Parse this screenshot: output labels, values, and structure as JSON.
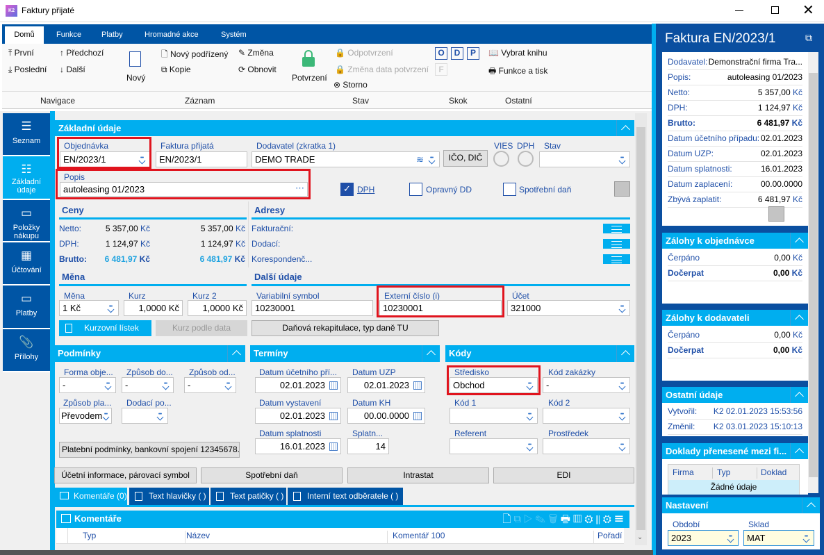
{
  "window": {
    "title": "Faktury přijaté",
    "logo": "K2"
  },
  "ribbon": {
    "tabs": [
      "Domů",
      "Funkce",
      "Platby",
      "Hromadné akce",
      "Systém"
    ],
    "active_tab": "Domů",
    "navigace": {
      "first": "První",
      "prev": "Předchozí",
      "last": "Poslední",
      "next": "Další",
      "group": "Navigace"
    },
    "zaznam": {
      "new": "Nový",
      "new_child": "Nový podřízený",
      "copy": "Kopie",
      "change": "Změna",
      "refresh": "Obnovit",
      "group": "Záznam"
    },
    "stav": {
      "confirm": "Potvrzení",
      "unconfirm": "Odpotvrzení",
      "change_date": "Změna data potvrzení",
      "storno": "Storno",
      "group": "Stav"
    },
    "skok": {
      "o": "O",
      "d": "D",
      "p": "P",
      "f": "F",
      "group": "Skok"
    },
    "ostatni": {
      "book": "Vybrat knihu",
      "print": "Funkce a tisk",
      "group": "Ostatní"
    }
  },
  "nav": [
    {
      "label": "Seznam",
      "icon": "list-icon"
    },
    {
      "label": "Základní údaje",
      "icon": "bullet-list-icon",
      "active": true
    },
    {
      "label": "Položky nákupu",
      "icon": "box-icon"
    },
    {
      "label": "Účtování",
      "icon": "calculator-icon"
    },
    {
      "label": "Platby",
      "icon": "box-icon"
    },
    {
      "label": "Přílohy",
      "icon": "paperclip-icon"
    }
  ],
  "zakladni": {
    "title": "Základní údaje",
    "objednavka": {
      "label": "Objednávka",
      "value": "EN/2023/1"
    },
    "faktura": {
      "label": "Faktura přijatá",
      "value": "EN/2023/1"
    },
    "dodavatel": {
      "label": "Dodavatel (zkratka 1)",
      "value": "DEMO TRADE"
    },
    "ico_dic": "IČO, DIČ",
    "vies": "VIES",
    "dph_status": "DPH",
    "stav": {
      "label": "Stav",
      "value": ""
    },
    "popis": {
      "label": "Popis",
      "value": "autoleasing 01/2023"
    },
    "dph_check": {
      "label": "DPH",
      "checked": true
    },
    "opravny": {
      "label": "Opravný DD",
      "checked": false
    },
    "spotrebni": {
      "label": "Spotřební daň",
      "checked": false
    }
  },
  "ceny": {
    "title": "Ceny",
    "rows": [
      {
        "label": "Netto:",
        "v1": "5 357,00",
        "v2": "5 357,00",
        "cur": "Kč"
      },
      {
        "label": "DPH:",
        "v1": "1 124,97",
        "v2": "1 124,97",
        "cur": "Kč"
      },
      {
        "label": "Brutto:",
        "v1": "6 481,97",
        "v2": "6 481,97",
        "cur": "Kč"
      }
    ]
  },
  "adresy": {
    "title": "Adresy",
    "rows": [
      "Fakturační:",
      "Dodací:",
      "Korespondenč..."
    ]
  },
  "mena": {
    "title": "Měna",
    "mena": {
      "label": "Měna",
      "value": "1 Kč"
    },
    "kurz": {
      "label": "Kurz",
      "value": "1,0000 Kč"
    },
    "kurz2": {
      "label": "Kurz 2",
      "value": "1,0000 Kč"
    },
    "kurzovni": "Kurzovní lístek",
    "kurz_podle": "Kurz podle data"
  },
  "dalsi": {
    "title": "Další údaje",
    "vs": {
      "label": "Variabilní symbol",
      "value": "10230001"
    },
    "ext": {
      "label": "Externí číslo (i)",
      "value": "10230001"
    },
    "ucet": {
      "label": "Účet",
      "value": "321000"
    },
    "rekap": "Daňová rekapitulace, typ daně TU"
  },
  "podminky": {
    "title": "Podmínky",
    "forma": {
      "label": "Forma obje...",
      "value": "-"
    },
    "zpusob_do": {
      "label": "Způsob do...",
      "value": "-"
    },
    "zpusob_od": {
      "label": "Způsob od...",
      "value": "-"
    },
    "zpusob_pla": {
      "label": "Způsob pla...",
      "value": "Převodem"
    },
    "dodaci": {
      "label": "Dodací po...",
      "value": ""
    },
    "button": "Platební podmínky, bankovní spojení 12345678..."
  },
  "terminy": {
    "title": "Termíny",
    "ucetni": {
      "label": "Datum účetního pří...",
      "value": "02.01.2023"
    },
    "uzp": {
      "label": "Datum UZP",
      "value": "02.01.2023"
    },
    "vystaveni": {
      "label": "Datum vystavení",
      "value": "02.01.2023"
    },
    "kh": {
      "label": "Datum KH",
      "value": "00.00.0000"
    },
    "splatnosti": {
      "label": "Datum splatnosti",
      "value": "16.01.2023"
    },
    "splatn": {
      "label": "Splatn...",
      "value": "14"
    }
  },
  "kody": {
    "title": "Kódy",
    "stredisko": {
      "label": "Středisko",
      "value": "Obchod"
    },
    "zakazka": {
      "label": "Kód zakázky",
      "value": "-"
    },
    "kod1": {
      "label": "Kód 1",
      "value": ""
    },
    "kod2": {
      "label": "Kód 2",
      "value": ""
    },
    "referent": {
      "label": "Referent",
      "value": ""
    },
    "prostredek": {
      "label": "Prostředek",
      "value": ""
    }
  },
  "bottom_buttons": [
    "Účetní informace, párovací symbol",
    "Spotřební daň",
    "Intrastat",
    "EDI"
  ],
  "tabs": [
    "Komentáře (0)",
    "Text hlavičky ( )",
    "Text patičky ( )",
    "Interní text odběratele ( )"
  ],
  "komentare": {
    "title": "Komentáře",
    "columns": [
      "Typ",
      "Název",
      "Komentář 100",
      "Pořadí"
    ]
  },
  "right": {
    "title": "Faktura EN/2023/1",
    "rows": [
      {
        "k": "Dodavatel:",
        "v": "Demonstrační firma Tra..."
      },
      {
        "k": "Popis:",
        "v": "autoleasing 01/2023"
      },
      {
        "k": "Netto:",
        "v": "5 357,00",
        "c": "Kč"
      },
      {
        "k": "DPH:",
        "v": "1 124,97",
        "c": "Kč"
      },
      {
        "k": "Brutto:",
        "v": "6 481,97",
        "c": "Kč",
        "bold": true
      },
      {
        "k": "Datum účetního případu:",
        "v": "02.01.2023"
      },
      {
        "k": "Datum UZP:",
        "v": "02.01.2023"
      },
      {
        "k": "Datum splatnosti:",
        "v": "16.01.2023"
      },
      {
        "k": "Datum zaplacení:",
        "v": "00.00.0000"
      },
      {
        "k": "Zbývá zaplatit:",
        "v": "6 481,97",
        "c": "Kč"
      }
    ],
    "zal_obj": {
      "title": "Zálohy k objednávce",
      "cerpano": "Čerpáno",
      "cerpano_v": "0,00",
      "docerpat": "Dočerpat",
      "docerpat_v": "0,00",
      "cur": "Kč"
    },
    "zal_dod": {
      "title": "Zálohy k dodavateli",
      "cerpano": "Čerpáno",
      "cerpano_v": "0,00",
      "docerpat": "Dočerpat",
      "docerpat_v": "0,00",
      "cur": "Kč"
    },
    "ostatni": {
      "title": "Ostatní údaje",
      "vytvoril": "Vytvořil:",
      "vytvoril_v": "K2 02.01.2023 15:53:56",
      "zmenil": "Změnil:",
      "zmenil_v": "K2 03.01.2023 15:10:13"
    },
    "doklady": {
      "title": "Doklady přenesené mezi fi...",
      "columns": [
        "Firma",
        "Typ",
        "Doklad"
      ],
      "empty": "Žádné údaje"
    },
    "nastaveni": {
      "title": "Nastavení",
      "obdobi": {
        "label": "Období",
        "value": "2023"
      },
      "sklad": {
        "label": "Sklad",
        "value": "MAT"
      }
    }
  },
  "colors": {
    "brand_dark": "#0055a5",
    "accent": "#00aeef",
    "highlight": "#e0141e"
  }
}
